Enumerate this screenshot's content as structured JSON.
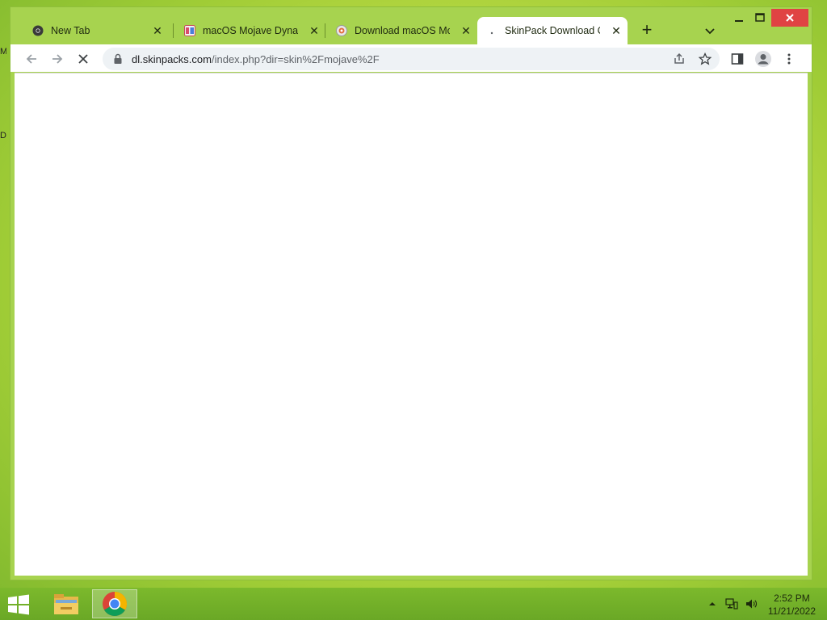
{
  "desktop": {
    "fragments": [
      "M",
      "D"
    ]
  },
  "browser": {
    "tabs": [
      {
        "title": "New Tab",
        "icon": "chrome-icon",
        "active": false
      },
      {
        "title": "macOS Mojave Dynamic",
        "icon": "skinpack-icon",
        "active": false
      },
      {
        "title": "Download macOS Mojave",
        "icon": "site-icon",
        "active": false
      },
      {
        "title": "SkinPack Download Center",
        "icon": "loading-icon",
        "active": true
      }
    ],
    "new_tab_label": "+",
    "address": {
      "host": "dl.skinpacks.com",
      "path": "/index.php?dir=skin%2Fmojave%2F"
    }
  },
  "taskbar": {
    "apps": [
      {
        "name": "file-explorer",
        "active": false
      },
      {
        "name": "chrome",
        "active": true
      }
    ],
    "clock": {
      "time": "2:52 PM",
      "date": "11/21/2022"
    }
  },
  "colors": {
    "accent": "#a7d34f",
    "close_button": "#e04343"
  }
}
